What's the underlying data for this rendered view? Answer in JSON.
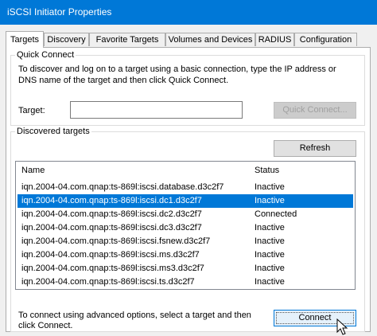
{
  "window": {
    "title": "iSCSI Initiator Properties"
  },
  "tabs": [
    {
      "label": "Targets",
      "active": true
    },
    {
      "label": "Discovery",
      "active": false
    },
    {
      "label": "Favorite Targets",
      "active": false
    },
    {
      "label": "Volumes and Devices",
      "active": false
    },
    {
      "label": "RADIUS",
      "active": false
    },
    {
      "label": "Configuration",
      "active": false
    }
  ],
  "quick_connect": {
    "legend": "Quick Connect",
    "description_line1": "To discover and log on to a target using a basic connection, type the IP address or",
    "description_line2": "DNS name of the target and then click Quick Connect.",
    "target_label": "Target:",
    "target_value": "",
    "button_label": "Quick Connect..."
  },
  "discovered": {
    "legend": "Discovered targets",
    "refresh_label": "Refresh",
    "columns": [
      "Name",
      "Status"
    ],
    "rows": [
      {
        "name": "iqn.2004-04.com.qnap:ts-869l:iscsi.database.d3c2f7",
        "status": "Inactive",
        "selected": false
      },
      {
        "name": "iqn.2004-04.com.qnap:ts-869l:iscsi.dc1.d3c2f7",
        "status": "Inactive",
        "selected": true
      },
      {
        "name": "iqn.2004-04.com.qnap:ts-869l:iscsi.dc2.d3c2f7",
        "status": "Connected",
        "selected": false
      },
      {
        "name": "iqn.2004-04.com.qnap:ts-869l:iscsi.dc3.d3c2f7",
        "status": "Inactive",
        "selected": false
      },
      {
        "name": "iqn.2004-04.com.qnap:ts-869l:iscsi.fsnew.d3c2f7",
        "status": "Inactive",
        "selected": false
      },
      {
        "name": "iqn.2004-04.com.qnap:ts-869l:iscsi.ms.d3c2f7",
        "status": "Inactive",
        "selected": false
      },
      {
        "name": "iqn.2004-04.com.qnap:ts-869l:iscsi.ms3.d3c2f7",
        "status": "Inactive",
        "selected": false
      },
      {
        "name": "iqn.2004-04.com.qnap:ts-869l:iscsi.ts.d3c2f7",
        "status": "Inactive",
        "selected": false
      }
    ],
    "hint_line1": "To connect using advanced options, select a target and then",
    "hint_line2": "click Connect.",
    "connect_label": "Connect"
  },
  "colors": {
    "titlebar": "#0078d7",
    "selection": "#0078d7",
    "window_bg": "#f0f0f0"
  }
}
